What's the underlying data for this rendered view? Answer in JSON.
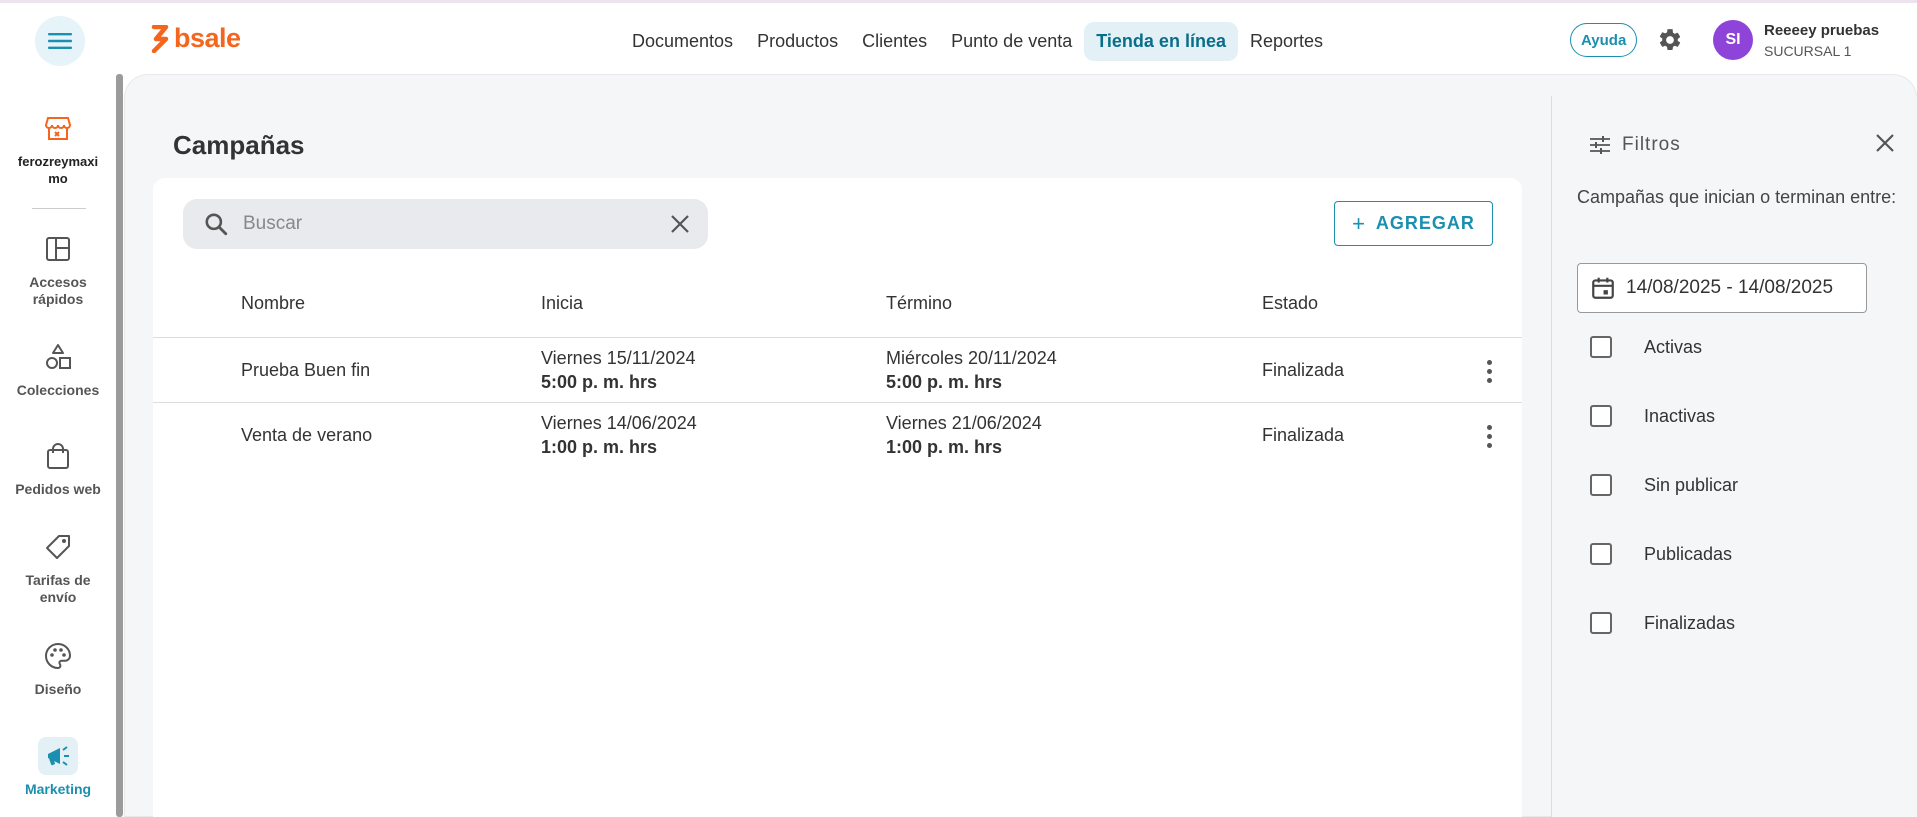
{
  "topbar": {
    "logo_text": "bsale",
    "nav": [
      "Documentos",
      "Productos",
      "Clientes",
      "Punto de venta",
      "Tienda en línea",
      "Reportes"
    ],
    "nav_active": "Tienda en línea",
    "help_label": "Ayuda",
    "user": {
      "initials": "SI",
      "name": "Reeeey pruebas",
      "branch": "SUCURSAL 1",
      "avatar_color": "#8e44d8"
    }
  },
  "sidebar": {
    "store": {
      "label": "ferozreymaximo",
      "icon": "store-icon"
    },
    "items": [
      {
        "label": "Accesos rápidos",
        "icon": "dashboard-icon"
      },
      {
        "label": "Colecciones",
        "icon": "shapes-icon"
      },
      {
        "label": "Pedidos web",
        "icon": "shopping-bag-icon"
      },
      {
        "label": "Tarifas de envío",
        "icon": "tag-icon"
      },
      {
        "label": "Diseño",
        "icon": "palette-icon"
      },
      {
        "label": "Marketing",
        "icon": "megaphone-icon",
        "active": true
      }
    ]
  },
  "main": {
    "title": "Campañas",
    "search": {
      "placeholder": "Buscar",
      "value": ""
    },
    "add_label": "AGREGAR",
    "columns": [
      "Nombre",
      "Inicia",
      "Término",
      "Estado"
    ],
    "rows": [
      {
        "name": "Prueba Buen fin",
        "start_date": "Viernes 15/11/2024",
        "start_time": "5:00 p. m. hrs",
        "end_date": "Miércoles 20/11/2024",
        "end_time": "5:00 p. m. hrs",
        "status": "Finalizada"
      },
      {
        "name": "Venta de verano",
        "start_date": "Viernes 14/06/2024",
        "start_time": "1:00 p. m. hrs",
        "end_date": "Viernes 21/06/2024",
        "end_time": "1:00 p. m. hrs",
        "status": "Finalizada"
      }
    ]
  },
  "filters": {
    "title": "Filtros",
    "description": "Campañas que inician o terminan entre:",
    "date_range": "14/08/2025 - 14/08/2025",
    "options": [
      "Activas",
      "Inactivas",
      "Sin publicar",
      "Publicadas",
      "Finalizadas"
    ]
  },
  "colors": {
    "accent": "#1a8fb0",
    "brand": "#f4661e"
  }
}
